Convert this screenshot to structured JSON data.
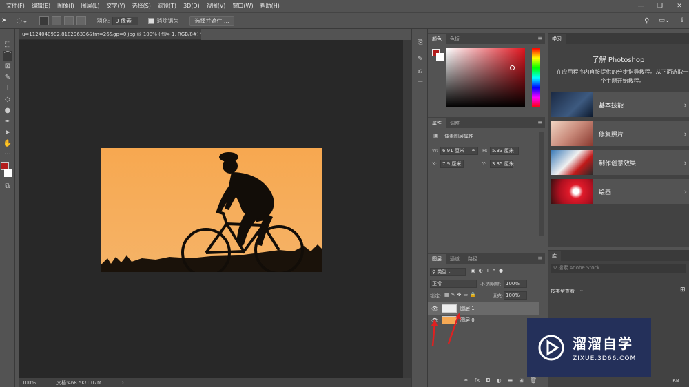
{
  "menu": [
    "文件(F)",
    "编辑(E)",
    "图像(I)",
    "图层(L)",
    "文字(Y)",
    "选择(S)",
    "滤镜(T)",
    "3D(D)",
    "视图(V)",
    "窗口(W)",
    "帮助(H)"
  ],
  "window_controls": {
    "minimize": "—",
    "maximize": "❐",
    "close": "✕"
  },
  "options": {
    "feather_label": "羽化:",
    "feather_value": "0 像素",
    "antialias_label": "消除锯齿",
    "select_mask_button": "选择并遮住 ..."
  },
  "document": {
    "tab_title": "u=1124040902,818296336&fm=26&gp=0.jpg @ 100% (图层 1, RGB/8#) *",
    "tab_close": "×",
    "zoom": "100%",
    "doc_size": "文档:468.5K/1.07M",
    "status_arrow": "›"
  },
  "color_panel": {
    "tabs": [
      "颜色",
      "色板"
    ],
    "fg_color": "#b21c1c",
    "bg_color": "#ffffff"
  },
  "properties_panel": {
    "tabs": [
      "属性",
      "调整"
    ],
    "title": "像素图层属性",
    "w_label": "W:",
    "w_value": "6.91 厘米",
    "h_label": "H:",
    "h_value": "5.33 厘米",
    "x_label": "X:",
    "x_value": "7.9 厘米",
    "y_label": "Y:",
    "y_value": "3.35 厘米"
  },
  "layers_panel": {
    "tabs": [
      "图层",
      "通道",
      "路径"
    ],
    "filter_type": "类型",
    "blend_mode": "正常",
    "opacity_label": "不透明度:",
    "opacity_value": "100%",
    "lock_label": "锁定:",
    "fill_label": "填充:",
    "fill_value": "100%",
    "layers": [
      {
        "name": "图层 1",
        "selected": true
      },
      {
        "name": "图层 0",
        "selected": false
      }
    ],
    "bottom_icons": [
      "link-icon",
      "fx-icon",
      "mask-icon",
      "adjustment-icon",
      "folder-icon",
      "new-layer-icon",
      "trash-icon"
    ]
  },
  "learn_panel": {
    "tab": "学习",
    "heading": "了解 Photoshop",
    "desc": "在应用程序内直接提供的分步指导教程。从下面选取一个主题开始教程。",
    "items": [
      "基本技能",
      "修复照片",
      "制作创意效果",
      "绘画"
    ]
  },
  "library_panel": {
    "tab": "库",
    "search_placeholder": "搜索 Adobe Stock",
    "view_label": "按类型查看",
    "size_label": "— KB"
  },
  "watermark": {
    "cn": "溜溜自学",
    "en": "ZIXUE.3D66.COM"
  }
}
